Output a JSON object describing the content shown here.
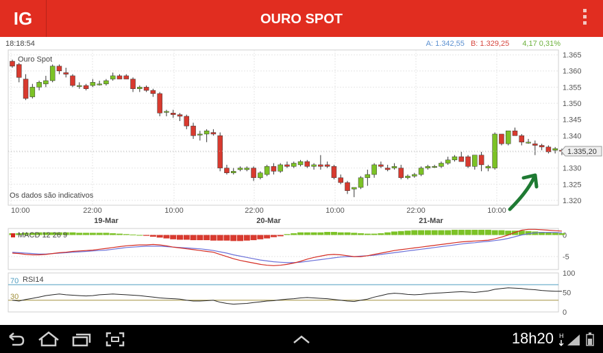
{
  "app": {
    "logo": "IG",
    "title": "OURO SPOT"
  },
  "info": {
    "time": "18:18:54",
    "ask_label": "A:",
    "ask": "1.342,55",
    "bid_label": "B:",
    "bid": "1.329,25",
    "change": "4,17",
    "change_pct": "0,31%"
  },
  "chart_data": {
    "type": "candlestick",
    "series_label": "Ouro Spot",
    "note": "Os dados são indicativos",
    "current_price_label": "1.335,20",
    "current_price": 1335.2,
    "price_ticks": [
      "1.365",
      "1.360",
      "1.355",
      "1.350",
      "1.345",
      "1.340",
      "1.335",
      "1.330",
      "1.325",
      "1.320"
    ],
    "price_tick_values": [
      1365,
      1360,
      1355,
      1350,
      1345,
      1340,
      1335,
      1330,
      1325,
      1320
    ],
    "ylim": [
      1318.5,
      1366.5
    ],
    "x_labels": [
      "10:00",
      "22:00",
      "10:00",
      "22:00",
      "10:00",
      "22:00",
      "10:00"
    ],
    "date_labels": [
      "19-Mar",
      "20-Mar",
      "21-Mar"
    ],
    "colors": {
      "up": "#7cc226",
      "down": "#d83a2f",
      "macd": "#d42a20",
      "signal": "#6a6fd8",
      "rsi": "#222222",
      "rsi_band": "#4b9bbf",
      "rsi_low": "#a08f3a"
    },
    "candles": [
      [
        1363,
        1363.5,
        1361,
        1361.5
      ],
      [
        1362,
        1362.5,
        1356.5,
        1358
      ],
      [
        1357.5,
        1359,
        1351,
        1351.5
      ],
      [
        1352,
        1356,
        1351.5,
        1355
      ],
      [
        1355,
        1357,
        1354,
        1356.5
      ],
      [
        1356,
        1358.5,
        1355,
        1357
      ],
      [
        1357,
        1362,
        1356.5,
        1361.5
      ],
      [
        1361.5,
        1362,
        1359,
        1360
      ],
      [
        1359.5,
        1361,
        1358,
        1359
      ],
      [
        1358.5,
        1359,
        1355,
        1355.5
      ],
      [
        1355.5,
        1356.5,
        1354.5,
        1355.5
      ],
      [
        1355.5,
        1356,
        1354,
        1354.5
      ],
      [
        1355.5,
        1357.5,
        1355,
        1356.5
      ],
      [
        1356,
        1357,
        1355.5,
        1356
      ],
      [
        1356,
        1357.5,
        1355.5,
        1357
      ],
      [
        1357.5,
        1359.5,
        1357,
        1358.5
      ],
      [
        1358.5,
        1359,
        1357.5,
        1357.5
      ],
      [
        1358.5,
        1359,
        1357.5,
        1357.5
      ],
      [
        1357.5,
        1358,
        1353.5,
        1354.5
      ],
      [
        1354.5,
        1355.5,
        1353.5,
        1355
      ],
      [
        1355,
        1355.5,
        1353.5,
        1354
      ],
      [
        1354,
        1354.5,
        1352,
        1353
      ],
      [
        1353,
        1353.5,
        1346,
        1347
      ],
      [
        1347.5,
        1348,
        1346,
        1347.5
      ],
      [
        1347,
        1348,
        1345.5,
        1346.5
      ],
      [
        1346.5,
        1347,
        1344.5,
        1346
      ],
      [
        1346,
        1346.5,
        1342,
        1343
      ],
      [
        1343,
        1344,
        1339,
        1340
      ],
      [
        1340.5,
        1341.5,
        1338.5,
        1340.5
      ],
      [
        1340.5,
        1342,
        1338,
        1341.5
      ],
      [
        1341,
        1342,
        1340,
        1340.5
      ],
      [
        1340,
        1341,
        1329,
        1330
      ],
      [
        1330,
        1331,
        1328,
        1328.5
      ],
      [
        1328.5,
        1330,
        1328,
        1329
      ],
      [
        1329.5,
        1330.5,
        1329,
        1330
      ],
      [
        1329.5,
        1330.5,
        1329,
        1330
      ],
      [
        1330,
        1330.5,
        1326,
        1327
      ],
      [
        1327,
        1329,
        1326.5,
        1328.5
      ],
      [
        1328,
        1331,
        1327.5,
        1330.5
      ],
      [
        1330.5,
        1331.5,
        1328,
        1329
      ],
      [
        1329,
        1331.5,
        1328.5,
        1331
      ],
      [
        1331,
        1332,
        1330,
        1330.5
      ],
      [
        1330.5,
        1332,
        1330,
        1331.5
      ],
      [
        1331,
        1332.5,
        1330.5,
        1332
      ],
      [
        1332,
        1332.5,
        1330,
        1330.5
      ],
      [
        1330.5,
        1331.5,
        1329.5,
        1331
      ],
      [
        1331,
        1334,
        1329.5,
        1330.5
      ],
      [
        1331,
        1332,
        1330,
        1330.5
      ],
      [
        1330.5,
        1331,
        1326.5,
        1327
      ],
      [
        1327,
        1328,
        1325,
        1325.5
      ],
      [
        1325.5,
        1326,
        1322,
        1323
      ],
      [
        1323.5,
        1324,
        1321,
        1324
      ],
      [
        1324,
        1327.5,
        1323.5,
        1327
      ],
      [
        1327,
        1329.5,
        1324.5,
        1328
      ],
      [
        1328,
        1331.5,
        1327,
        1331
      ],
      [
        1331,
        1332,
        1330,
        1330.5
      ],
      [
        1330,
        1331,
        1329,
        1329.5
      ],
      [
        1330,
        1331.5,
        1329.5,
        1330.5
      ],
      [
        1330,
        1331,
        1326.5,
        1327
      ],
      [
        1327,
        1328,
        1326.5,
        1327.5
      ],
      [
        1327.5,
        1328.5,
        1327,
        1328
      ],
      [
        1328,
        1330.5,
        1327.5,
        1330
      ],
      [
        1330,
        1331,
        1329.5,
        1330.5
      ],
      [
        1330.5,
        1331,
        1330,
        1330.5
      ],
      [
        1330.5,
        1332,
        1330,
        1331.5
      ],
      [
        1331.5,
        1333.5,
        1331,
        1332.5
      ],
      [
        1332.5,
        1334,
        1332,
        1333.5
      ],
      [
        1333.5,
        1335,
        1333,
        1332
      ],
      [
        1333.5,
        1334,
        1330,
        1330.5
      ],
      [
        1330.5,
        1334,
        1329.5,
        1334
      ],
      [
        1334,
        1335,
        1329,
        1331
      ],
      [
        1330,
        1331,
        1329,
        1330.5
      ],
      [
        1330,
        1341,
        1329.5,
        1340.5
      ],
      [
        1340.5,
        1340.5,
        1337,
        1337.5
      ],
      [
        1337.5,
        1341.5,
        1337,
        1341.5
      ],
      [
        1341.5,
        1342.5,
        1340,
        1340
      ],
      [
        1340,
        1340.5,
        1337,
        1338
      ],
      [
        1338,
        1339,
        1337.5,
        1338
      ],
      [
        1337.5,
        1338.5,
        1334,
        1337
      ],
      [
        1337,
        1337.5,
        1335.5,
        1336.5
      ],
      [
        1336.5,
        1337,
        1334.5,
        1335
      ],
      [
        1335.5,
        1336.5,
        1334.5,
        1336
      ],
      [
        1335.5,
        1336,
        1334,
        1335.2
      ]
    ],
    "macd": {
      "label": "MACD 12 26 9",
      "ticks": [
        "0",
        "-5"
      ],
      "tick_values": [
        0,
        -5
      ],
      "ylim": [
        -8,
        1.5
      ],
      "macd_line": [
        -4.2,
        -4.3,
        -4.5,
        -4.6,
        -4.6,
        -4.5,
        -4.3,
        -4.1,
        -4.0,
        -3.8,
        -3.7,
        -3.6,
        -3.5,
        -3.3,
        -3.1,
        -2.9,
        -2.7,
        -2.5,
        -2.4,
        -2.3,
        -2.3,
        -2.2,
        -2.3,
        -2.5,
        -2.8,
        -3.0,
        -3.2,
        -3.4,
        -3.6,
        -3.8,
        -4.0,
        -4.5,
        -5.0,
        -5.5,
        -5.9,
        -6.2,
        -6.5,
        -6.8,
        -7.0,
        -7.1,
        -7.0,
        -6.8,
        -6.5,
        -6.1,
        -5.6,
        -5.2,
        -4.9,
        -4.6,
        -4.5,
        -4.6,
        -4.8,
        -5.0,
        -5.0,
        -4.8,
        -4.5,
        -4.2,
        -3.9,
        -3.6,
        -3.4,
        -3.2,
        -3.0,
        -2.8,
        -2.6,
        -2.4,
        -2.2,
        -2.0,
        -1.8,
        -1.6,
        -1.5,
        -1.4,
        -1.3,
        -1.2,
        -0.9,
        -0.5,
        0,
        0.6,
        1.1,
        1.3,
        1.3,
        1.2,
        1.1,
        1.0,
        0.9
      ],
      "signal_line": [
        -4.0,
        -4.1,
        -4.2,
        -4.3,
        -4.4,
        -4.4,
        -4.3,
        -4.2,
        -4.1,
        -4.0,
        -3.9,
        -3.8,
        -3.7,
        -3.6,
        -3.5,
        -3.3,
        -3.1,
        -2.9,
        -2.8,
        -2.7,
        -2.6,
        -2.6,
        -2.6,
        -2.7,
        -2.8,
        -2.9,
        -3.0,
        -3.1,
        -3.2,
        -3.4,
        -3.6,
        -3.9,
        -4.2,
        -4.6,
        -4.9,
        -5.2,
        -5.5,
        -5.8,
        -6.0,
        -6.2,
        -6.3,
        -6.4,
        -6.4,
        -6.3,
        -6.1,
        -5.9,
        -5.7,
        -5.5,
        -5.3,
        -5.1,
        -5.0,
        -5.0,
        -4.9,
        -4.8,
        -4.7,
        -4.5,
        -4.3,
        -4.1,
        -3.9,
        -3.7,
        -3.5,
        -3.3,
        -3.1,
        -2.9,
        -2.7,
        -2.5,
        -2.3,
        -2.1,
        -1.9,
        -1.8,
        -1.6,
        -1.5,
        -1.3,
        -1.1,
        -0.8,
        -0.4,
        0,
        0.3,
        0.5,
        0.6,
        0.6,
        0.6,
        0.5
      ],
      "histogram": [
        0.4,
        0.4,
        0.5,
        0.5,
        0.6,
        0.6,
        0.6,
        0.6,
        0.6,
        0.6,
        0.5,
        0.5,
        0.5,
        0.5,
        0.5,
        0.4,
        0.3,
        0.2,
        0.1,
        0,
        -0.2,
        -0.4,
        -0.6,
        -0.8,
        -1.0,
        -1.1,
        -1.1,
        -1.2,
        -1.2,
        -1.2,
        -1.3,
        -1.3,
        -1.3,
        -1.4,
        -1.4,
        -1.3,
        -1.2,
        -1.0,
        -0.8,
        -0.5,
        -0.3,
        0.2,
        0.4,
        0.6,
        0.6,
        0.6,
        0.6,
        0.7,
        0.7,
        0.6,
        0.6,
        0.5,
        0.4,
        0.3,
        0.3,
        0.4,
        0.6,
        0.8,
        0.9,
        1.0,
        1.1,
        1.1,
        1.1,
        1.1,
        1.1,
        1.1,
        1.2,
        1.2,
        1.2,
        1.2,
        1.2,
        1.2,
        1.1,
        1.1,
        1.0,
        1.0,
        1.0,
        0.9,
        0.8,
        0.7,
        0.6,
        0.5,
        0.4
      ]
    },
    "rsi": {
      "label": "RSI14",
      "band_high_label": "70",
      "band_low_label": "30",
      "band_high": 70,
      "band_low": 30,
      "ticks": [
        "100",
        "50",
        "0"
      ],
      "tick_values": [
        100,
        50,
        0
      ],
      "values": [
        30,
        28,
        32,
        35,
        38,
        42,
        44,
        46,
        44,
        43,
        42,
        41,
        42,
        44,
        45,
        46,
        45,
        44,
        43,
        42,
        40,
        38,
        36,
        35,
        34,
        33,
        30,
        28,
        28,
        29,
        30,
        25,
        22,
        20,
        21,
        22,
        24,
        26,
        28,
        29,
        31,
        33,
        34,
        36,
        37,
        36,
        35,
        34,
        32,
        30,
        28,
        27,
        30,
        33,
        38,
        42,
        46,
        48,
        47,
        45,
        44,
        45,
        47,
        48,
        49,
        50,
        51,
        52,
        51,
        50,
        52,
        54,
        58,
        60,
        62,
        61,
        60,
        58,
        57,
        55,
        54,
        53,
        53
      ]
    }
  },
  "nav": {
    "clock": "18h20"
  }
}
